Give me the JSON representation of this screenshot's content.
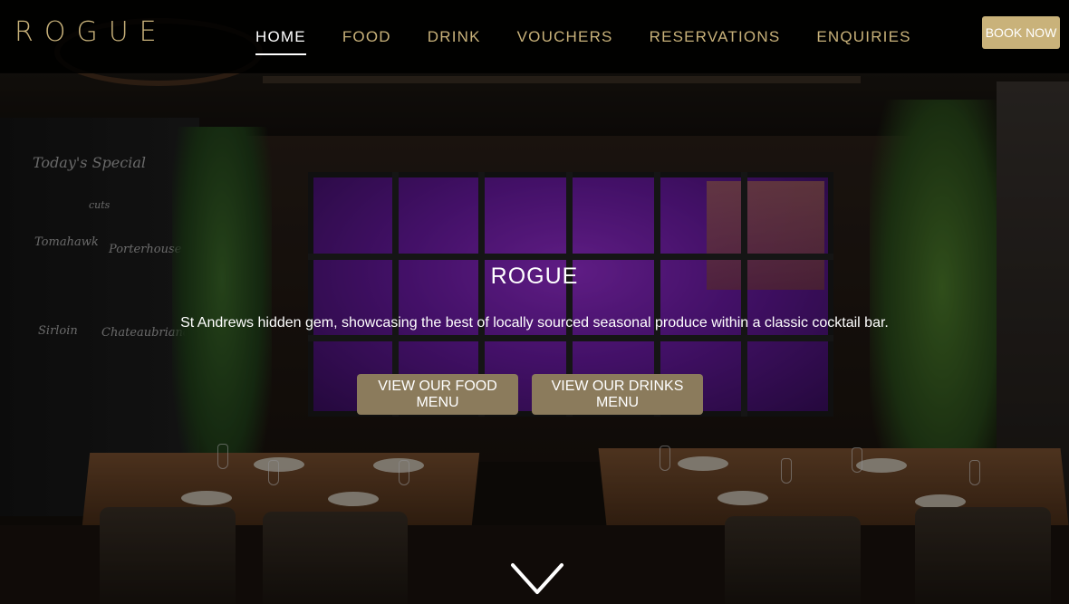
{
  "brand": {
    "logo_text": "ROGUE",
    "accent_color": "#c9b27a"
  },
  "nav": {
    "items": [
      {
        "label": "HOME",
        "active": true
      },
      {
        "label": "FOOD",
        "active": false
      },
      {
        "label": "DRINK",
        "active": false
      },
      {
        "label": "VOUCHERS",
        "active": false
      },
      {
        "label": "RESERVATIONS",
        "active": false
      },
      {
        "label": "ENQUIRIES",
        "active": false
      }
    ],
    "book_now_label": "BOOK NOW"
  },
  "hero": {
    "title": "ROGUE",
    "subtitle": "St Andrews hidden gem, showcasing the best of locally sourced seasonal produce within a classic cocktail bar.",
    "food_menu_button": "VIEW OUR FOOD MENU",
    "drinks_menu_button": "VIEW OUR DRINKS MENU",
    "scroll_icon": "chevron-down-icon",
    "button_color": "#8b7b5c"
  },
  "chalkboard": {
    "heading": "Today's Special",
    "subheading": "cuts",
    "items": [
      "Tomahawk",
      "Porterhouse",
      "Sirloin",
      "Chateaubriand"
    ]
  }
}
